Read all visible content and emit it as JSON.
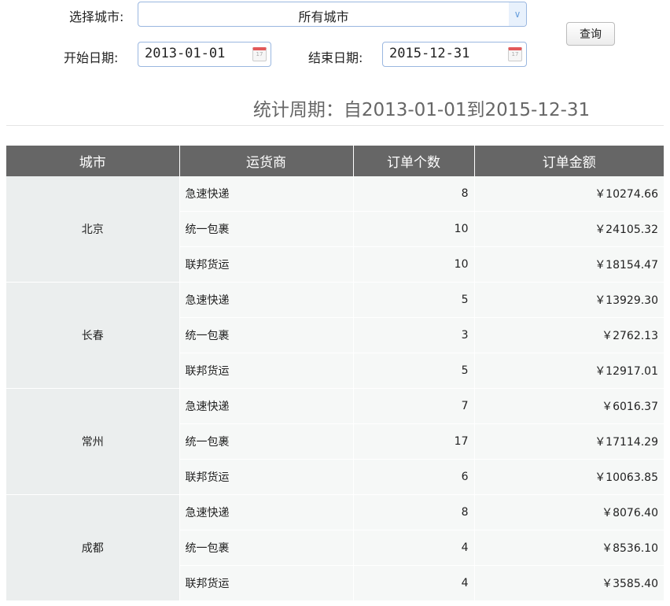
{
  "filters": {
    "city_label": "选择城市:",
    "city_value": "所有城市",
    "start_label": "开始日期:",
    "start_value": "2013-01-01",
    "end_label": "结束日期:",
    "end_value": "2015-12-31",
    "query_button": "查询"
  },
  "period_text": "统计周期：自2013-01-01到2015-12-31",
  "table": {
    "headers": [
      "城市",
      "运货商",
      "订单个数",
      "订单金额"
    ],
    "groups": [
      {
        "city": "北京",
        "rows": [
          [
            "急速快递",
            "8",
            "￥10274.66"
          ],
          [
            "统一包裹",
            "10",
            "￥24105.32"
          ],
          [
            "联邦货运",
            "10",
            "￥18154.47"
          ]
        ]
      },
      {
        "city": "长春",
        "rows": [
          [
            "急速快递",
            "5",
            "￥13929.30"
          ],
          [
            "统一包裹",
            "3",
            "￥2762.13"
          ],
          [
            "联邦货运",
            "5",
            "￥12917.01"
          ]
        ]
      },
      {
        "city": "常州",
        "rows": [
          [
            "急速快递",
            "7",
            "￥6016.37"
          ],
          [
            "统一包裹",
            "17",
            "￥17114.29"
          ],
          [
            "联邦货运",
            "6",
            "￥10063.85"
          ]
        ]
      },
      {
        "city": "成都",
        "rows": [
          [
            "急速快递",
            "8",
            "￥8076.40"
          ],
          [
            "统一包裹",
            "4",
            "￥8536.10"
          ],
          [
            "联邦货运",
            "4",
            "￥3585.40"
          ]
        ]
      }
    ]
  }
}
